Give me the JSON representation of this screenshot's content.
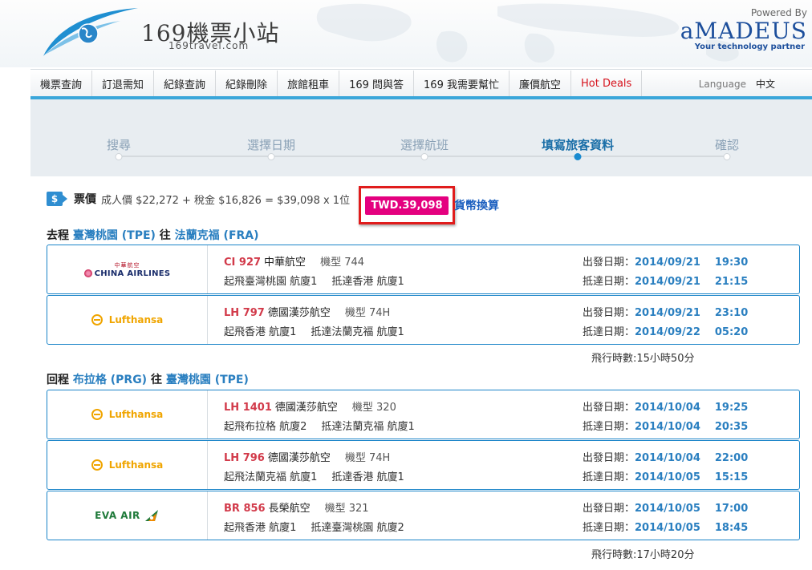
{
  "header": {
    "site_title": "169機票小站",
    "site_url": "169travel.com",
    "powered_by": "Powered By",
    "partner_brand": "aMADEUS",
    "partner_tagline": "Your technology partner"
  },
  "nav": {
    "items": [
      {
        "label": "機票查詢"
      },
      {
        "label": "訂退需知"
      },
      {
        "label": "紀錄查詢"
      },
      {
        "label": "紀錄刪除"
      },
      {
        "label": "旅館租車"
      },
      {
        "label": "169 問與答"
      },
      {
        "label": "169 我需要幫忙"
      },
      {
        "label": "廉價航空"
      },
      {
        "label": "Hot Deals"
      }
    ],
    "language_label": "Language",
    "language_value": "中文",
    "hot_color": "#d6111b"
  },
  "steps": [
    {
      "label": "搜尋",
      "active": false
    },
    {
      "label": "選擇日期",
      "active": false
    },
    {
      "label": "選擇航班",
      "active": false
    },
    {
      "label": "填寫旅客資料",
      "active": true
    },
    {
      "label": "確認",
      "active": false
    }
  ],
  "price": {
    "icon": "dollar-icon",
    "label": "票價",
    "detail": "成人價 $22,272 + 稅金 $16,826 = $39,098 x 1位",
    "total": "TWD.39,098",
    "currency_link": "貨幣換算"
  },
  "outbound": {
    "direction": "去程",
    "from": "臺灣桃園 (TPE)",
    "verb": "往",
    "to": "法蘭克福 (FRA)",
    "duration": "飛行時數:15小時50分",
    "flights": [
      {
        "logo": "china-airlines",
        "logo_text_top": "中華航空",
        "logo_text": "CHINA AIRLINES",
        "flight_no": "CI 927",
        "airline": "中華航空",
        "model": "機型 744",
        "route": "起飛臺灣桃園 航廈1",
        "arrive": "抵達香港 航廈1",
        "dep_label": "出發日期：",
        "dep_date": "2014/09/21",
        "dep_time": "19:30",
        "arr_label": "抵達日期：",
        "arr_date": "2014/09/21",
        "arr_time": "21:15"
      },
      {
        "logo": "lufthansa",
        "logo_text": "Lufthansa",
        "flight_no": "LH 797",
        "airline": "德國漢莎航空",
        "model": "機型 74H",
        "route": "起飛香港 航廈1",
        "arrive": "抵達法蘭克福 航廈1",
        "dep_label": "出發日期：",
        "dep_date": "2014/09/21",
        "dep_time": "23:10",
        "arr_label": "抵達日期：",
        "arr_date": "2014/09/22",
        "arr_time": "05:20"
      }
    ]
  },
  "inbound": {
    "direction": "回程",
    "from": "布拉格 (PRG)",
    "verb": "往",
    "to": "臺灣桃園 (TPE)",
    "duration": "飛行時數:17小時20分",
    "flights": [
      {
        "logo": "lufthansa",
        "logo_text": "Lufthansa",
        "flight_no": "LH 1401",
        "airline": "德國漢莎航空",
        "model": "機型 320",
        "route": "起飛布拉格 航廈2",
        "arrive": "抵達法蘭克福 航廈1",
        "dep_label": "出發日期：",
        "dep_date": "2014/10/04",
        "dep_time": "19:25",
        "arr_label": "抵達日期：",
        "arr_date": "2014/10/04",
        "arr_time": "20:35"
      },
      {
        "logo": "lufthansa",
        "logo_text": "Lufthansa",
        "flight_no": "LH 796",
        "airline": "德國漢莎航空",
        "model": "機型 74H",
        "route": "起飛法蘭克福 航廈1",
        "arrive": "抵達香港 航廈1",
        "dep_label": "出發日期：",
        "dep_date": "2014/10/04",
        "dep_time": "22:00",
        "arr_label": "抵達日期：",
        "arr_date": "2014/10/05",
        "arr_time": "15:15"
      },
      {
        "logo": "eva-air",
        "logo_text": "EVA AIR",
        "flight_no": "BR 856",
        "airline": "長榮航空",
        "model": "機型 321",
        "route": "起飛香港 航廈1",
        "arrive": "抵達臺灣桃園 航廈2",
        "dep_label": "出發日期：",
        "dep_date": "2014/10/05",
        "dep_time": "17:00",
        "arr_label": "抵達日期：",
        "arr_date": "2014/10/05",
        "arr_time": "18:45"
      }
    ]
  },
  "colors": {
    "accent": "#1a84c8",
    "flight_number": "#d23a4a",
    "total_badge": "#e4007f",
    "highlight_border": "#e01c1c"
  }
}
